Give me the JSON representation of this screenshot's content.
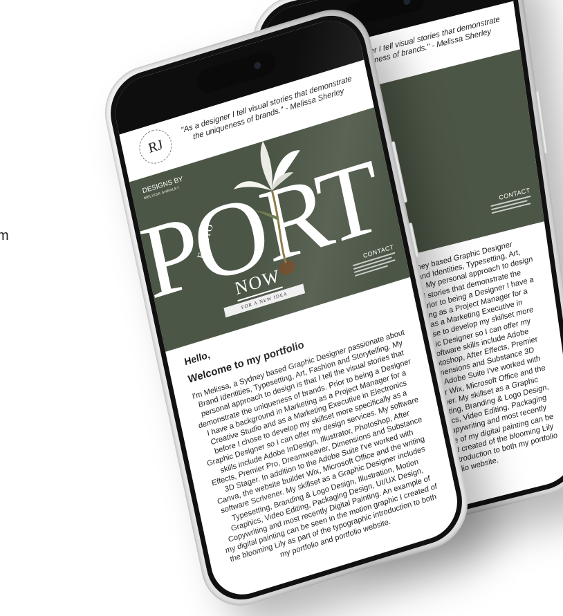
{
  "edge_text": "m",
  "portfolio": {
    "logo": "RJ",
    "quote": "\"As a designer I tell visual stories that demonstrate the uniqueness of brands.\" - Melissa Sherley",
    "designs_by": "DESIGNS BY",
    "designs_by_name": "MELISSA SHERLEY",
    "hero_word": "PORT",
    "hero_word_back": "RT",
    "folio": "FOLIO",
    "now": "NOW",
    "ribbon": "FOR A NEW IDEA",
    "contact_title": "CONTACT",
    "greeting": "Hello,",
    "welcome": "Welcome to my portfolio",
    "intro": "I'm Melissa, a Sydney based Graphic Designer passionate about Brand Identities, Typesetting, Art, Fashion and Storytelling. My personal approach to design is that I tell the visual stories that demonstrate the uniqueness of brands. Prior to being a Designer I have a background in Marketing as a Project Manager for a Creative Studio and as a Marketing Executive in Electronics before I chose to develop my skillset more specifically as a Graphic Designer so I can offer my design services. My software skills include Adobe InDesign, Illustrator, Photoshop, After Effects, Premier Pro, Dreamweaver, Dimensions and Substance 3D Stager. In addition to the Adobe Suite I've worked with Canva, the website builder Wix, Microsoft Office and the writing software Scrivener. My skillset as a Graphic Designer includes Typesetting, Branding & Logo Design, Illustration, Motion Graphics, Video Editing, Packaging Design, UI/UX Design, Copywriting and most recently Digital Painting. An example of my digital painting can be seen in the motion graphic I created of the blooming Lily as part of the typographic introduction to both my portfolio and portfolio website."
  },
  "colors": {
    "hero_bg": "#4c5646",
    "phone_frame": "#d9d9d9",
    "bezel": "#111111"
  }
}
